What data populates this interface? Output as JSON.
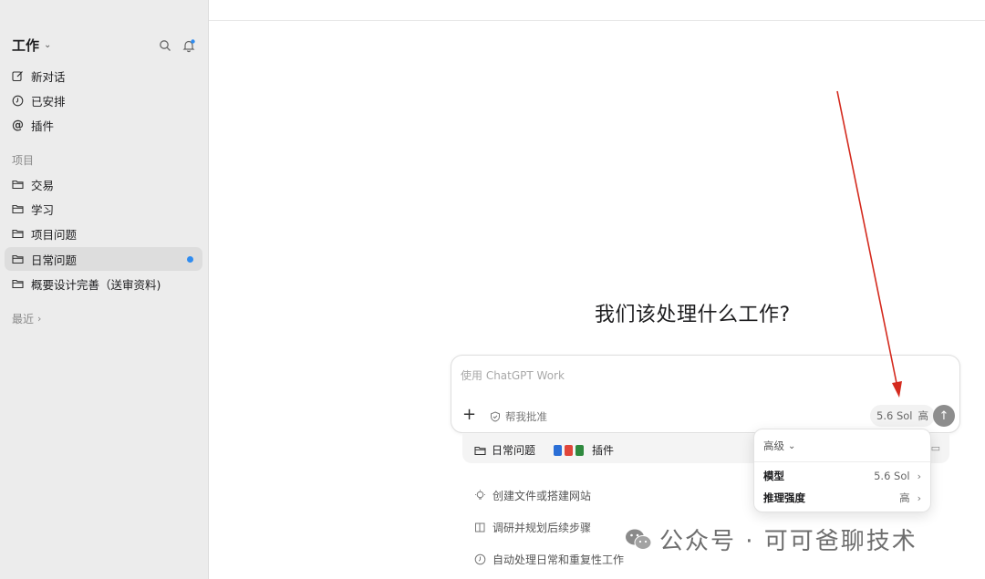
{
  "window": {
    "controls": {
      "close_color": "#ee5e58",
      "minimize_color": "#d8d8d8",
      "zoom_color": "#3fc24c"
    }
  },
  "sidebar": {
    "workspace": "工作",
    "nav": [
      {
        "label": "新对话",
        "icon": "edit-icon"
      },
      {
        "label": "已安排",
        "icon": "clock-icon"
      },
      {
        "label": "插件",
        "icon": "at-icon"
      }
    ],
    "projects_label": "项目",
    "projects": [
      {
        "label": "交易",
        "icon": "folder-icon"
      },
      {
        "label": "学习",
        "icon": "folder-icon"
      },
      {
        "label": "项目问题",
        "icon": "folder-icon"
      },
      {
        "label": "日常问题",
        "icon": "folder-icon",
        "active": true,
        "unread": true
      },
      {
        "label": "概要设计完善（送审资料)",
        "icon": "folder-icon"
      }
    ],
    "recent_label": "最近"
  },
  "main": {
    "headline": "我们该处理什么工作?",
    "composer": {
      "placeholder": "使用 ChatGPT Work",
      "approve_label": "帮我批准",
      "model": "5.6 Sol",
      "effort": "高"
    },
    "context": {
      "folder": "日常问题",
      "plugins_label": "插件",
      "plugin_colors": [
        "#2b6fd6",
        "#e0463b",
        "#2f8a3f"
      ]
    },
    "suggestions": [
      {
        "label": "创建文件或搭建网站",
        "icon": "bulb-icon"
      },
      {
        "label": "调研并规划后续步骤",
        "icon": "book-icon"
      },
      {
        "label": "自动处理日常和重复性工作",
        "icon": "clock-icon"
      }
    ],
    "menu": {
      "header": "高级",
      "rows": [
        {
          "key": "模型",
          "value": "5.6 Sol"
        },
        {
          "key": "推理强度",
          "value": "高"
        }
      ]
    },
    "annotation_arrow_color": "#d42a1e"
  },
  "watermark": "公众号 · 可可爸聊技术"
}
